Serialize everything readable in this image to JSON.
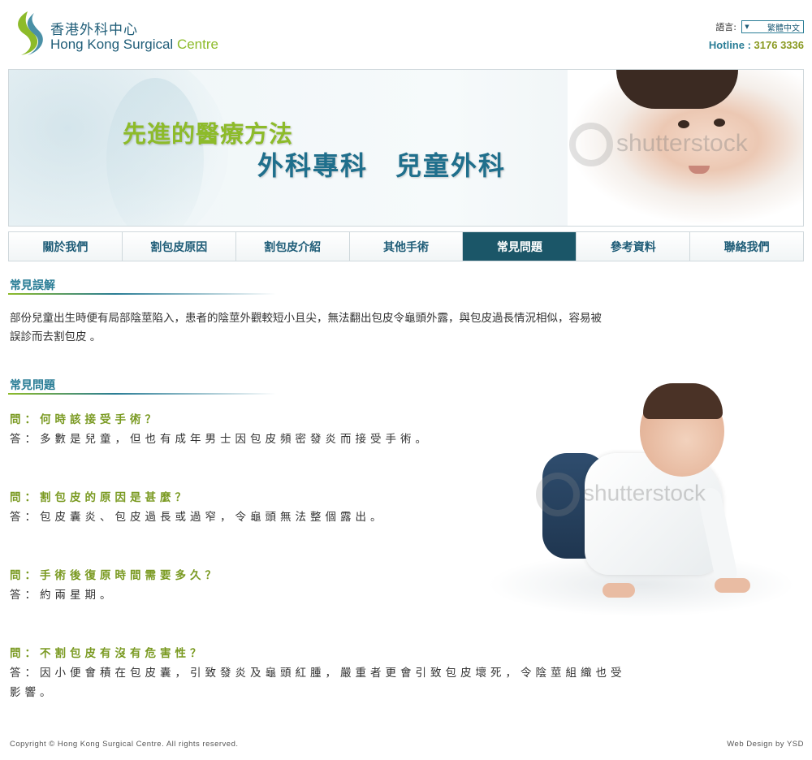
{
  "brand": {
    "name_cn": "香港外科中心",
    "name_en_part1": "Hong Kong Surgical",
    "name_en_part2": "Centre",
    "accent_color": "#8dbb2a",
    "primary_color": "#1f5d78"
  },
  "header": {
    "language_label": "語言:",
    "language_selected": "繁體中文",
    "hotline_label": "Hotline :",
    "hotline_number": "3176 3336"
  },
  "banner": {
    "line1": "先進的醫療方法",
    "line2": "外科專科　兒童外科",
    "watermark": "shutterstock"
  },
  "nav": {
    "items": [
      {
        "label": "關於我們",
        "active": false
      },
      {
        "label": "割包皮原因",
        "active": false
      },
      {
        "label": "割包皮介紹",
        "active": false
      },
      {
        "label": "其他手術",
        "active": false
      },
      {
        "label": "常見問題",
        "active": true
      },
      {
        "label": "參考資料",
        "active": false
      },
      {
        "label": "聯絡我們",
        "active": false
      }
    ]
  },
  "misconception": {
    "title": "常見誤解",
    "text": "部份兒童出生時便有局部陰莖陷入，患者的陰莖外觀較短小且尖，無法翻出包皮令龜頭外露，與包皮過長情況相似，容易被誤診而去割包皮 。"
  },
  "faq": {
    "title": "常見問題",
    "items": [
      {
        "q": "問：何時該接受手術？",
        "a": "答：多數是兒童，但也有成年男士因包皮頻密發炎而接受手術。"
      },
      {
        "q": "問：割包皮的原因是甚麼？",
        "a": "答：包皮囊炎、包皮過長或過窄，令龜頭無法整個露出。"
      },
      {
        "q": "問：手術後復原時間需要多久？",
        "a": "答：約兩星期。"
      },
      {
        "q": "問：不割包皮有沒有危害性？",
        "a": "答：因小便會積在包皮囊，引致發炎及龜頭紅腫，嚴重者更會引致包皮壞死，令陰莖組織也受影響。"
      }
    ]
  },
  "photo": {
    "watermark": "shutterstock"
  },
  "footer": {
    "copyright": "Copyright © Hong Kong Surgical Centre. All rights reserved.",
    "credit": "Web Design by YSD"
  }
}
